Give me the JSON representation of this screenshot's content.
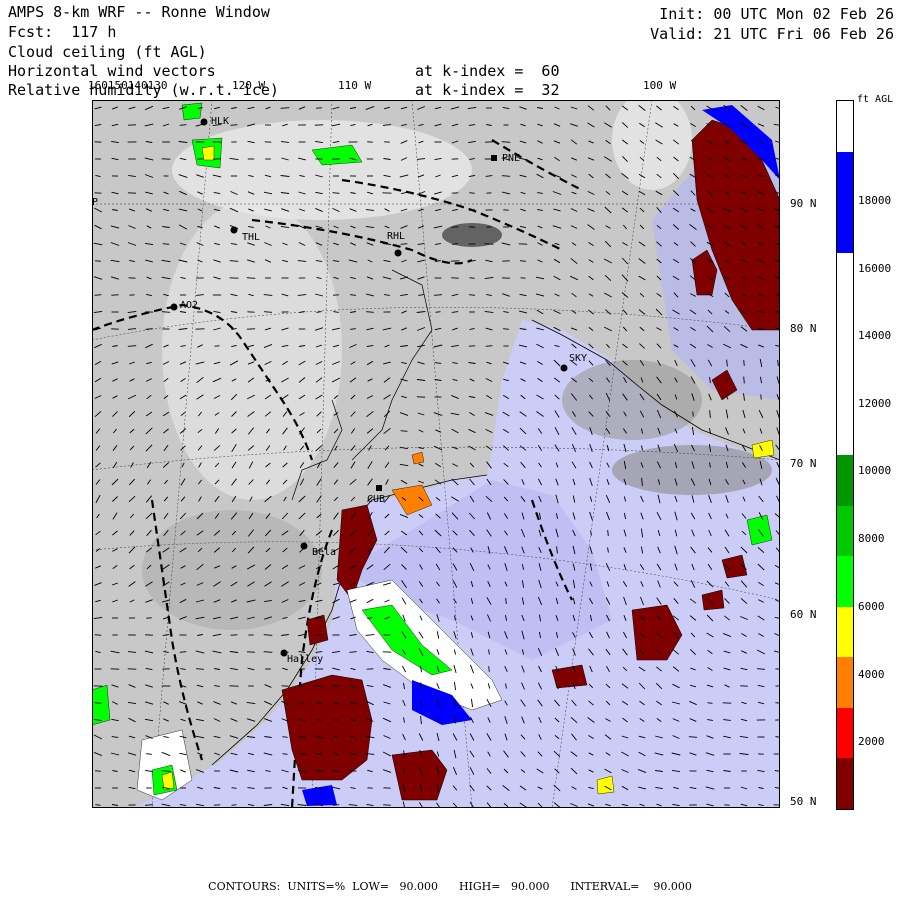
{
  "header": {
    "title": "AMPS 8-km WRF -- Ronne Window",
    "forecast": "Fcst:  117 h",
    "field1": "Cloud ceiling (ft AGL)",
    "field2": "Horizontal wind vectors",
    "field3": "Relative humidity (w.r.t. ice)",
    "k_index_1": "at k-index =  60",
    "k_index_2": "at k-index =  32",
    "init": "Init: 00 UTC Mon 02 Feb 26",
    "valid": "Valid: 21 UTC Fri 06 Feb 26"
  },
  "longitude_labels": [
    "160150140130",
    "120 W",
    "110 W",
    "100 W"
  ],
  "latitude_labels": [
    "90 N",
    "80 N",
    "70 N",
    "60 N",
    "50 N"
  ],
  "stations": [
    "HLK",
    "PNE",
    "THL",
    "RHL",
    "AO2",
    "SKY",
    "CUB",
    "Bela",
    "Halley",
    "P"
  ],
  "colorbar": {
    "title": "ft AGL",
    "tick_labels": [
      "18000",
      "16000",
      "14000",
      "12000",
      "10000",
      "8000",
      "6000",
      "4000",
      "2000"
    ],
    "colors": [
      "#800000",
      "#ff0000",
      "#ff7f00",
      "#ffff00",
      "#00ff00",
      "#00c800",
      "#009600",
      "#ffffff",
      "#ffffff",
      "#ffffff",
      "#ffffff",
      "#0000ff",
      "#0000ff",
      "#ffffff"
    ]
  },
  "footer": "CONTOURS:  UNITS=%  LOW=   90.000      HIGH=   90.000      INTERVAL=    90.000",
  "palette": {
    "ocean": "#cccdf7",
    "land": "#c8c8c8",
    "ceiling_low": "#800000",
    "blue_high": "#0000ff",
    "green": "#00ff00"
  }
}
